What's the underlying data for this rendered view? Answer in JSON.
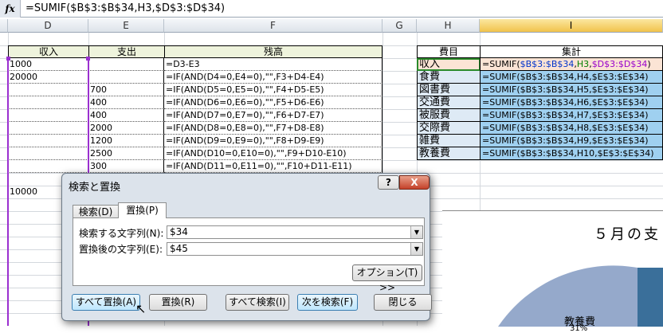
{
  "formula_bar": {
    "icon": "fx-icon",
    "label": "fx",
    "formula": "=SUMIF($B$3:$B$34,H3,$D$3:$D$34)"
  },
  "columns": [
    "D",
    "E",
    "F",
    "G",
    "H",
    "I"
  ],
  "table": {
    "headers": [
      "収入",
      "支出",
      "残高"
    ],
    "rows": [
      {
        "d": "1000",
        "e": "",
        "f": "=D3-E3"
      },
      {
        "d": "20000",
        "e": "",
        "f": "=IF(AND(D4=0,E4=0),\"\",F3+D4-E4)"
      },
      {
        "d": "",
        "e": "700",
        "f": "=IF(AND(D5=0,E5=0),\"\",F4+D5-E5)"
      },
      {
        "d": "",
        "e": "400",
        "f": "=IF(AND(D6=0,E6=0),\"\",F5+D6-E6)"
      },
      {
        "d": "",
        "e": "400",
        "f": "=IF(AND(D7=0,E7=0),\"\",F6+D7-E7)"
      },
      {
        "d": "",
        "e": "2000",
        "f": "=IF(AND(D8=0,E8=0),\"\",F7+D8-E8)"
      },
      {
        "d": "",
        "e": "1200",
        "f": "=IF(AND(D9=0,E9=0),\"\",F8+D9-E9)"
      },
      {
        "d": "",
        "e": "2500",
        "f": "=IF(AND(D10=0,E10=0),\"\",F9+D10-E10)"
      },
      {
        "d": "",
        "e": "300",
        "f": "=IF(AND(D11=0,E11=0),\"\",F10+D11-E11)"
      }
    ],
    "extra_d": "10000"
  },
  "summary": {
    "headers": [
      "費目",
      "集計"
    ],
    "rows": [
      {
        "h": "収入",
        "i": "=SUMIF($B$3:$B$34,H3,$D$3:$D$34)"
      },
      {
        "h": "食費",
        "i": "=SUMIF($B$3:$B$34,H4,$E$3:$E$34)"
      },
      {
        "h": "図書費",
        "i": "=SUMIF($B$3:$B$34,H5,$E$3:$E$34)"
      },
      {
        "h": "交通費",
        "i": "=SUMIF($B$3:$B$34,H6,$E$3:$E$34)"
      },
      {
        "h": "被服費",
        "i": "=SUMIF($B$3:$B$34,H7,$E$3:$E$34)"
      },
      {
        "h": "交際費",
        "i": "=SUMIF($B$3:$B$34,H8,$E$3:$E$34)"
      },
      {
        "h": "雑費",
        "i": "=SUMIF($B$3:$B$34,H9,$E$3:$E$34)"
      },
      {
        "h": "教養費",
        "i": "=SUMIF($B$3:$B$34,H10,$E$3:$E$34)"
      }
    ],
    "first_parts": [
      "=SUMIF(",
      "$B$3:$B$34",
      ",",
      "H3",
      ",",
      "$D$3:$D$34",
      ")"
    ],
    "ref_colors": [
      "#0033cc",
      "#008000",
      "#9900cc"
    ]
  },
  "chart": {
    "title": "５月の支",
    "slice_label": "教養費",
    "slice_pct": "31%",
    "colors": [
      "#95a9cb",
      "#3a6f9a"
    ]
  },
  "dialog": {
    "title": "検索と置換",
    "help": "?",
    "close": "X",
    "tabs": [
      "検索(D)",
      "置換(P)"
    ],
    "active_tab": 1,
    "find_label": "検索する文字列(N):",
    "find_value": "$34",
    "replace_label": "置換後の文字列(E):",
    "replace_value": "$45",
    "options_button": "オプション(T) >>",
    "buttons": [
      "すべて置換(A)",
      "置換(R)",
      "すべて検索(I)",
      "次を検索(F)",
      "閉じる"
    ]
  }
}
